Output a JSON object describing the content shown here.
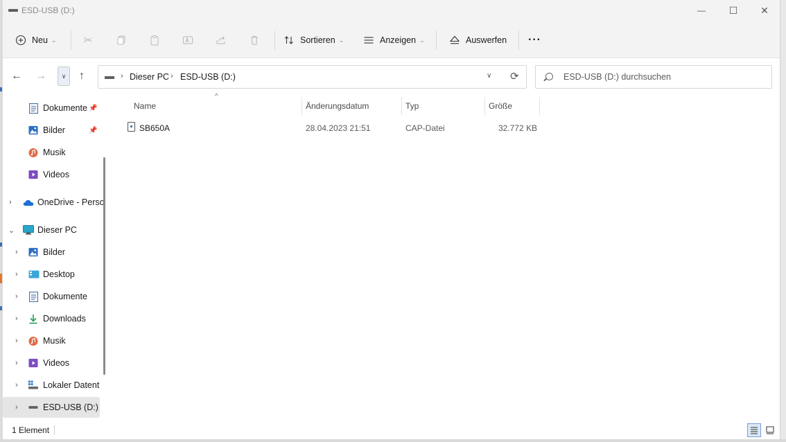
{
  "window": {
    "title": "ESD-USB (D:)",
    "controls": {
      "minimize": "—",
      "maximize": "☐",
      "close": "✕"
    }
  },
  "commandbar": {
    "new_label": "Neu",
    "sort_label": "Sortieren",
    "view_label": "Anzeigen",
    "eject_label": "Auswerfen",
    "more_label": "···"
  },
  "address": {
    "crumbs": [
      "Dieser PC",
      "ESD-USB (D:)"
    ],
    "separator": "›"
  },
  "search": {
    "placeholder": "ESD-USB (D:) durchsuchen"
  },
  "nav": {
    "items": [
      {
        "label": "Dokumente",
        "icon": "documents-icon",
        "pinned": true
      },
      {
        "label": "Bilder",
        "icon": "pictures-icon",
        "pinned": true
      },
      {
        "label": "Musik",
        "icon": "music-icon",
        "pinned": false
      },
      {
        "label": "Videos",
        "icon": "videos-icon",
        "pinned": false
      },
      {
        "label": "OneDrive - Perso",
        "icon": "onedrive-icon",
        "expand": "collapsed"
      },
      {
        "label": "Dieser PC",
        "icon": "this-pc-icon",
        "expand": "expanded"
      },
      {
        "label": "Bilder",
        "icon": "pictures-icon",
        "expand": "collapsed"
      },
      {
        "label": "Desktop",
        "icon": "desktop-icon",
        "expand": "collapsed"
      },
      {
        "label": "Dokumente",
        "icon": "documents-icon",
        "expand": "collapsed"
      },
      {
        "label": "Downloads",
        "icon": "downloads-icon",
        "expand": "collapsed"
      },
      {
        "label": "Musik",
        "icon": "music-icon",
        "expand": "collapsed"
      },
      {
        "label": "Videos",
        "icon": "videos-icon",
        "expand": "collapsed"
      },
      {
        "label": "Lokaler Datentr",
        "icon": "local-drive-icon",
        "expand": "collapsed"
      },
      {
        "label": "ESD-USB (D:)",
        "icon": "usb-drive-icon",
        "expand": "collapsed",
        "selected": true
      }
    ]
  },
  "list": {
    "columns": {
      "name": "Name",
      "modified": "Änderungsdatum",
      "type": "Typ",
      "size": "Größe"
    },
    "sort_indicator": "^",
    "rows": [
      {
        "name": "SB650A",
        "modified": "28.04.2023 21:51",
        "type": "CAP-Datei",
        "size": "32.772 KB"
      }
    ]
  },
  "status": {
    "count": "1 Element"
  },
  "colors": {
    "chrome_bg": "#f3f3f3",
    "accent": "#2e6fc2",
    "selected_bg": "#e5e5e5"
  }
}
